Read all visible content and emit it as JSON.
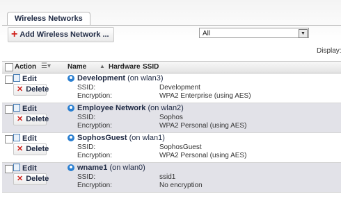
{
  "tab": {
    "label": "Wireless Networks"
  },
  "toolbar": {
    "add_label": "Add Wireless Network ..."
  },
  "filter": {
    "selected": "All"
  },
  "display_label": "Display:",
  "table": {
    "columns": {
      "action": "Action",
      "name": "Name",
      "hardware": "Hardware",
      "ssid": "SSID"
    },
    "edit_label": "Edit",
    "delete_label": "Delete",
    "ssid_label": "SSID:",
    "enc_label": "Encryption:",
    "rows": [
      {
        "name": "Development",
        "iface": " (on wlan3)",
        "ssid": "Development",
        "encryption": "WPA2 Enterprise (using AES)"
      },
      {
        "name": "Employee Network",
        "iface": " (on wlan2)",
        "ssid": "Sophos",
        "encryption": "WPA2 Personal (using AES)"
      },
      {
        "name": "SophosGuest",
        "iface": " (on wlan1)",
        "ssid": "SophosGuest",
        "encryption": "WPA2 Personal (using AES)"
      },
      {
        "name": "wname1",
        "iface": " (on wlan0)",
        "ssid": "ssid1",
        "encryption": "No encryption"
      }
    ]
  },
  "colors": {
    "accent": "#d0201a",
    "wifi": "#2b7fd0",
    "alt_row": "#e2e2e8"
  },
  "icons": {
    "add": "plus-icon",
    "edit": "pencil-icon",
    "delete": "x-icon",
    "network": "wifi-icon",
    "dropdown": "chevron-down-icon",
    "sort": "sort-asc-icon"
  }
}
